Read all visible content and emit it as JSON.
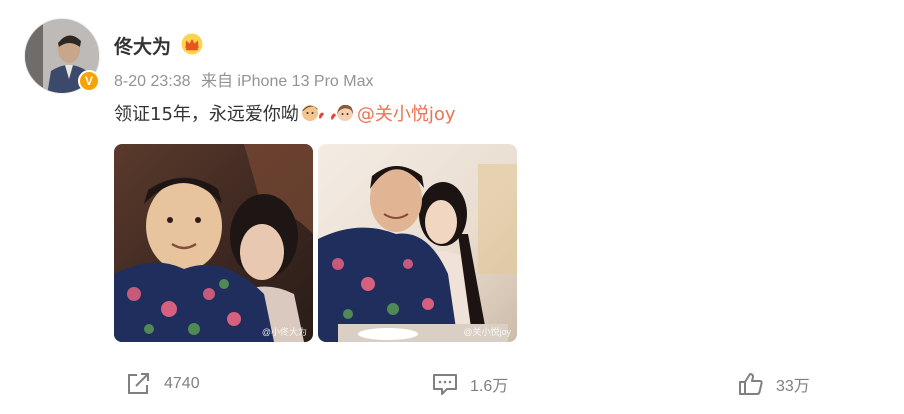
{
  "post": {
    "author_name": "佟大为",
    "timestamp": "8-20 23:38",
    "source": "来自 iPhone 13 Pro Max",
    "text": "领证15年，永远爱你呦",
    "mention": "@关小悦joy",
    "verified_badge": "V",
    "image_watermark_1": "@小佟大为",
    "image_watermark_2": "@关小悦joy"
  },
  "actions": {
    "repost_count": "4740",
    "comment_count": "1.6万",
    "like_count": "33万"
  },
  "colors": {
    "mention": "#eb7350",
    "meta": "#939393",
    "badge": "#f8a300",
    "action": "#808080"
  },
  "icons": {
    "repost": "share-icon",
    "comment": "comment-icon",
    "like": "thumbs-up-icon",
    "crown": "crown-icon"
  }
}
